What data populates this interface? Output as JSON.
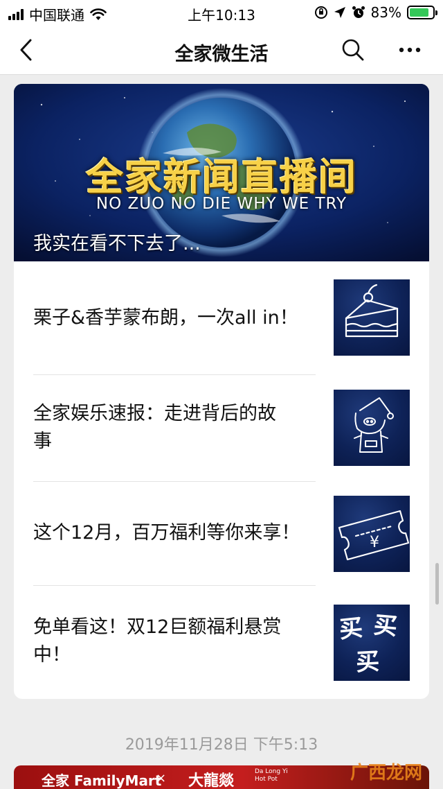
{
  "status_bar": {
    "carrier": "中国联通",
    "time": "上午10:13",
    "battery_percent": "83%",
    "battery_level": 0.83
  },
  "nav": {
    "title": "全家微生活"
  },
  "hero": {
    "title": "全家新闻直播间",
    "subtitle": "NO ZUO NO DIE WHY WE TRY",
    "caption": "我实在看不下去了..."
  },
  "articles": [
    {
      "title_line1": "栗子&香芋蒙布朗，一次all in！",
      "title_line2": "",
      "thumb_icon": "cake-slice-icon"
    },
    {
      "title_line1": "全家娱乐速报：走进背后的故",
      "title_line2": "事",
      "thumb_icon": "pig-santa-icon"
    },
    {
      "title_line1": "这个12月，百万福利等你来享！",
      "title_line2": "",
      "thumb_icon": "yuan-ticket-icon"
    },
    {
      "title_line1": "免单看这！双12巨额福利悬赏",
      "title_line2": "中！",
      "thumb_icon": "buy-buy-buy-icon"
    }
  ],
  "thumb_text": {
    "ticket_symbol": "¥",
    "buy": "买"
  },
  "timestamp": "2019年11月28日 下午5:13",
  "next_banner": {
    "brand": "全家 FamilyMart",
    "x": "×",
    "partner": "大龍燚",
    "partner_en_1": "Da Long Yi",
    "partner_en_2": "Hot Pot"
  },
  "watermark": "广西龙网",
  "colors": {
    "accent_gold": "#f7d148",
    "thumb_blue": "#0e2257",
    "battery_green": "#34c759",
    "banner_red": "#c41e1e"
  }
}
